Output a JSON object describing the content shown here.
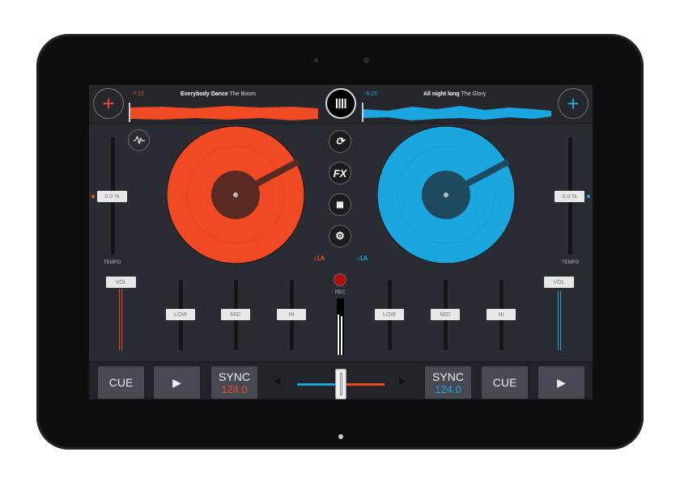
{
  "colors": {
    "left": "#f04a24",
    "right": "#1ca6e0",
    "bg": "#2a2c33"
  },
  "decks": [
    {
      "time": "-7:12",
      "title": "Everybody Dance",
      "artist": "The Boom",
      "tempo": "0.0 %",
      "tempo_label": "TEMPO",
      "key": "♪1A",
      "vol": "VOL",
      "eq": [
        "LOW",
        "MID",
        "HI"
      ],
      "cue": "CUE",
      "sync": "SYNC",
      "bpm": "124.0"
    },
    {
      "time": "-5:25",
      "title": "All night long",
      "artist": "The Glory",
      "tempo": "0.0 %",
      "tempo_label": "TEMPO",
      "key": "♪1A",
      "vol": "VOL",
      "eq": [
        "LOW",
        "MID",
        "HI"
      ],
      "cue": "CUE",
      "sync": "SYNC",
      "bpm": "124.0"
    }
  ],
  "center": {
    "fx": "FX",
    "rec": "REC",
    "icons": [
      "sync-icon",
      "fx-icon",
      "grid-icon",
      "gear-icon"
    ]
  },
  "play_symbol": "▶",
  "arrows": {
    "left": "◀",
    "right": "▶"
  },
  "crossfader_position": 0.5,
  "add_symbol": "+"
}
